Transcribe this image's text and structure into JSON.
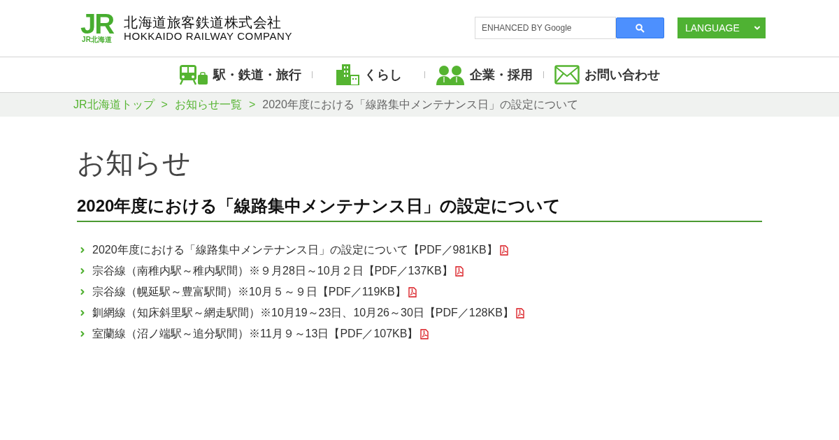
{
  "header": {
    "logo": {
      "mark": "JR",
      "mark_caption": "JR北海道",
      "name_ja": "北海道旅客鉄道株式会社",
      "name_en": "HOKKAIDO RAILWAY COMPANY"
    },
    "search": {
      "placeholder": "ENHANCED BY Google"
    },
    "language_select": {
      "value": "LANGUAGE"
    }
  },
  "nav": [
    {
      "label": "駅・鉄道・旅行"
    },
    {
      "label": "くらし"
    },
    {
      "label": "企業・採用"
    },
    {
      "label": "お問い合わせ"
    }
  ],
  "breadcrumb": [
    {
      "kind": "link",
      "label": "JR北海道トップ"
    },
    {
      "kind": "separator",
      "label": ">"
    },
    {
      "kind": "link",
      "label": "お知らせ一覧"
    },
    {
      "kind": "separator",
      "label": ">"
    },
    {
      "kind": "current",
      "label": "2020年度における「線路集中メンテナンス日」の設定について"
    }
  ],
  "page_title": "お知らせ",
  "article": {
    "title": "2020年度における「線路集中メンテナンス日」の設定について",
    "documents": [
      {
        "label": "2020年度における「線路集中メンテナンス日」の設定について【PDF／981KB】"
      },
      {
        "label": "宗谷線（南稚内駅～稚内駅間）※９月28日～10月２日【PDF／137KB】"
      },
      {
        "label": "宗谷線（幌延駅～豊富駅間）※10月５～９日【PDF／119KB】"
      },
      {
        "label": "釧網線（知床斜里駅～網走駅間）※10月19～23日、10月26～30日【PDF／128KB】"
      },
      {
        "label": "室蘭線（沼ノ端駅～追分駅間）※11月９～13日【PDF／107KB】"
      }
    ]
  }
}
